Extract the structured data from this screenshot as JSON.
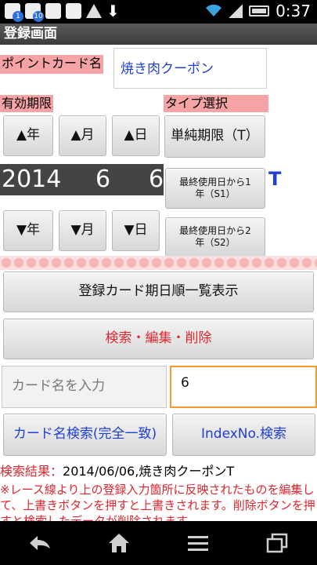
{
  "status_bar": {
    "time": "0:37",
    "badges": [
      "1",
      "10"
    ]
  },
  "title": "登録画面",
  "point_card_label": "ポイントカード名",
  "point_card_name": "焼き肉クーポン",
  "valid_period_label": "有効期限",
  "type_select_label": "タイプ選択",
  "date_buttons": {
    "year_up": "▲年",
    "month_up": "▲月",
    "day_up": "▲日",
    "year_down": "▼年",
    "month_down": "▼月",
    "day_down": "▼日"
  },
  "date_display": {
    "year": "2014",
    "month": "6",
    "day": "6"
  },
  "type_buttons": {
    "simple": "単純期限（T）",
    "s1": "最終使用日から1年（S1）",
    "s2": "最終使用日から2年（S2）"
  },
  "selected_type": "T",
  "list_button": "登録カード期日順一覧表示",
  "search_edit_button": "検索・編集・削除",
  "card_name_input_placeholder": "カード名を入力",
  "index_input_value": "6",
  "card_name_search_button": "カード名検索(完全一致)",
  "index_search_button": "IndexNo.検索",
  "result_label": "検索結果：",
  "result_value": "2014/06/06,焼き肉クーポンT",
  "note_text": "※レース線より上の登録入力箇所に反映されたものを編集して、上書きボタンを押すと上書きされます。削除ボタンを押すと検索したデータが削除されます。",
  "colors": {
    "accent_red": "#e0262e",
    "accent_blue": "#1f3fd6",
    "label_pink": "#f6a3a6",
    "focus_orange": "#f39a2c"
  }
}
